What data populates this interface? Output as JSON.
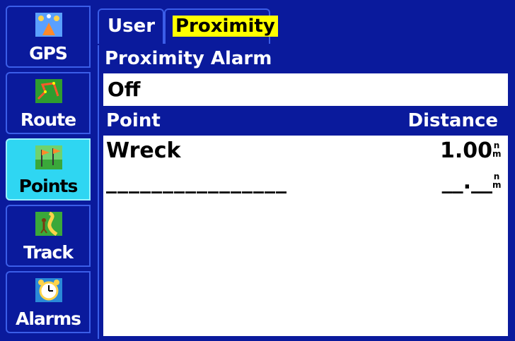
{
  "sidebar": {
    "items": [
      {
        "label": "GPS",
        "icon": "satellite-icon",
        "active": false
      },
      {
        "label": "Route",
        "icon": "route-icon",
        "active": false
      },
      {
        "label": "Points",
        "icon": "flags-icon",
        "active": true
      },
      {
        "label": "Track",
        "icon": "hiker-icon",
        "active": false
      },
      {
        "label": "Alarms",
        "icon": "alarm-clock-icon",
        "active": false
      }
    ]
  },
  "tabs": [
    {
      "label": "User",
      "active": false
    },
    {
      "label": "Proximity",
      "active": true
    }
  ],
  "proximity": {
    "section_label": "Proximity Alarm",
    "alarm_value": "Off"
  },
  "table": {
    "col_point": "Point",
    "col_distance": "Distance",
    "rows": [
      {
        "point": "Wreck",
        "distance": "1.00",
        "unit_top": "n",
        "unit_bottom": "m"
      },
      {
        "point": "________________",
        "distance": "__.__",
        "unit_top": "n",
        "unit_bottom": "m"
      }
    ]
  },
  "colors": {
    "background": "#0a1a9c",
    "active_tab": "#2fd6f2",
    "highlight": "#ffff00",
    "field": "#ffffff"
  }
}
